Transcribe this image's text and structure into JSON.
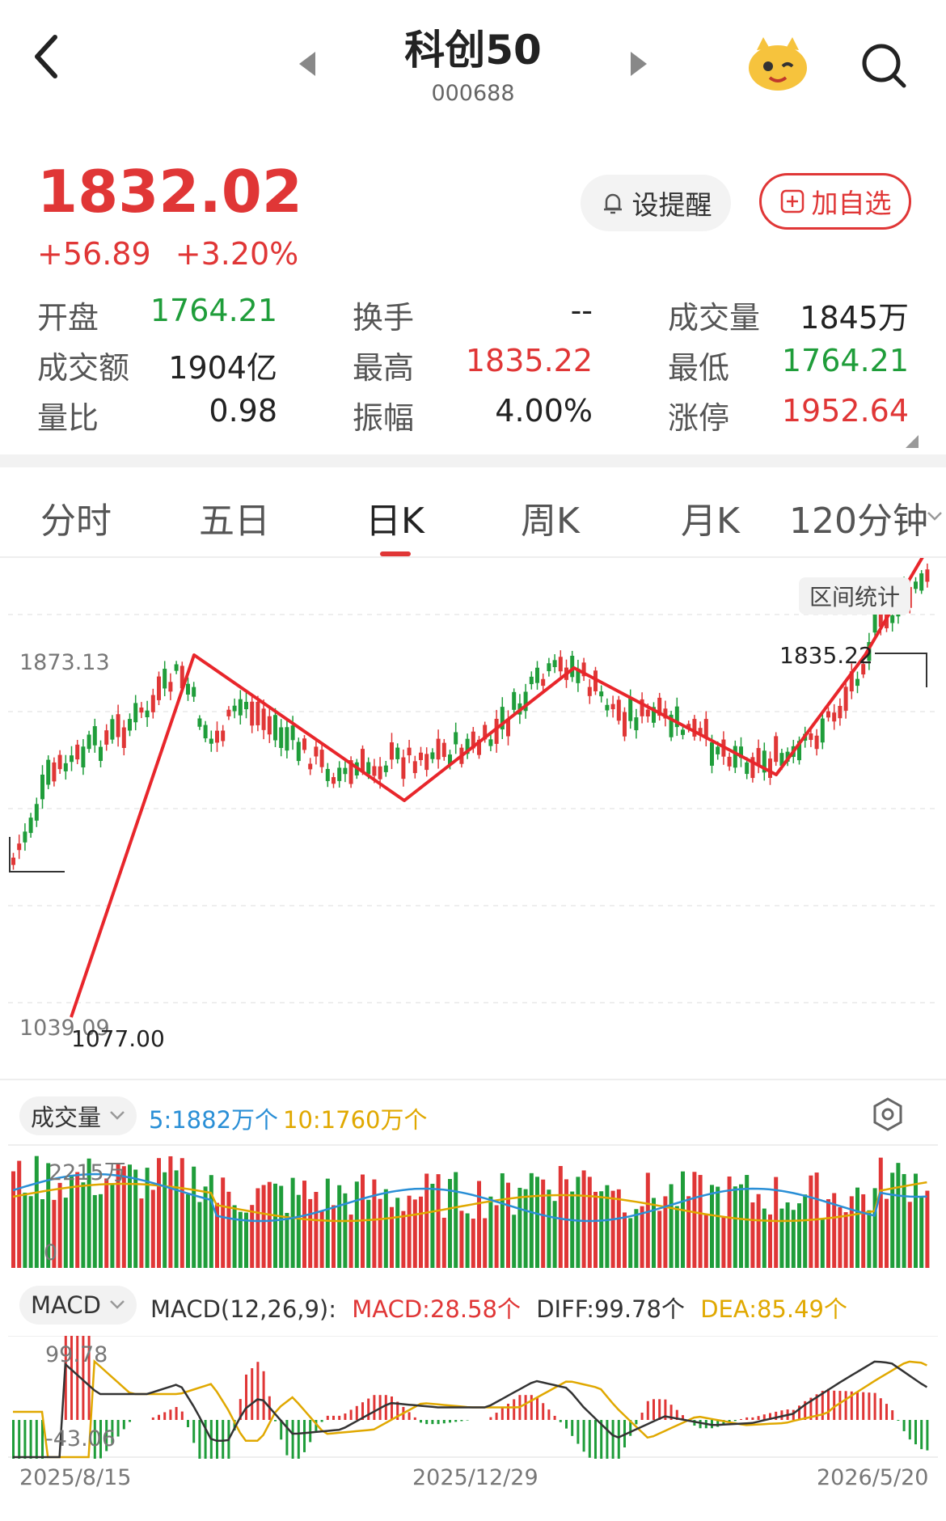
{
  "header": {
    "title": "科创50",
    "code": "000688"
  },
  "quote": {
    "price": "1832.02",
    "change": "+56.89",
    "change_pct": "+3.20%"
  },
  "actions": {
    "alert": "设提醒",
    "watchlist": "加自选"
  },
  "stats": [
    {
      "label": "开盘",
      "value": "1764.21",
      "color": "green"
    },
    {
      "label": "换手",
      "value": "--",
      "color": "dark"
    },
    {
      "label": "成交量",
      "value": "1845万",
      "color": "dark"
    },
    {
      "label": "成交额",
      "value": "1904亿",
      "color": "dark"
    },
    {
      "label": "最高",
      "value": "1835.22",
      "color": "red"
    },
    {
      "label": "最低",
      "value": "1764.21",
      "color": "green"
    },
    {
      "label": "量比",
      "value": "0.98",
      "color": "dark"
    },
    {
      "label": "振幅",
      "value": "4.00%",
      "color": "dark"
    },
    {
      "label": "涨停",
      "value": "1952.64",
      "color": "red"
    }
  ],
  "tabs": [
    "分时",
    "五日",
    "日K",
    "周K",
    "月K",
    "120分钟"
  ],
  "active_tab": "日K",
  "kline": {
    "range_stats": "区间统计",
    "y_top": "1873.13",
    "y_bottom": "1039.09",
    "high_mark": "1835.22",
    "low_mark": "1077.00"
  },
  "volume": {
    "indicator": "成交量",
    "ma5": "5:1882万个",
    "ma10": "10:1760万个",
    "y_top": "2215万",
    "y_bottom": "0"
  },
  "macd": {
    "indicator": "MACD",
    "params": "MACD(12,26,9):",
    "macd": "MACD:28.58个",
    "diff": "DIFF:99.78个",
    "dea": "DEA:85.49个",
    "y_top": "99.78",
    "y_bottom": "-43.06"
  },
  "dates": [
    "2025/8/15",
    "2025/12/29",
    "2026/5/20"
  ],
  "colors": {
    "up": "#e03636",
    "down": "#1f9d3a",
    "ma5": "#2a8fd6",
    "ma10": "#e0a800",
    "accent": "#e03636"
  }
}
